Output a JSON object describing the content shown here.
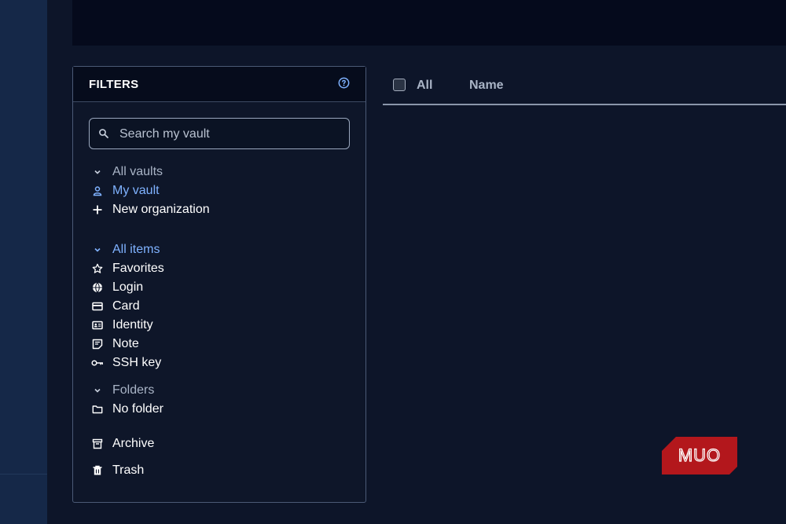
{
  "filters": {
    "title": "FILTERS",
    "search_placeholder": "Search my vault",
    "vaults_header": "All vaults",
    "vaults": [
      {
        "label": "My vault",
        "icon": "user-icon"
      },
      {
        "label": "New organization",
        "icon": "plus-icon"
      }
    ],
    "types_header": "All items",
    "types": [
      {
        "label": "Favorites",
        "icon": "star-icon"
      },
      {
        "label": "Login",
        "icon": "globe-icon"
      },
      {
        "label": "Card",
        "icon": "credit-card-icon"
      },
      {
        "label": "Identity",
        "icon": "id-card-icon"
      },
      {
        "label": "Note",
        "icon": "note-icon"
      },
      {
        "label": "SSH key",
        "icon": "key-icon"
      }
    ],
    "folders_header": "Folders",
    "folders": [
      {
        "label": "No folder",
        "icon": "folder-icon"
      }
    ],
    "archive_label": "Archive",
    "trash_label": "Trash"
  },
  "list": {
    "col_all": "All",
    "col_name": "Name"
  },
  "watermark": {
    "text": "MUO"
  },
  "colors": {
    "background": "#0d1529",
    "accent": "#7fb2ff",
    "watermark": "#b3171c"
  }
}
